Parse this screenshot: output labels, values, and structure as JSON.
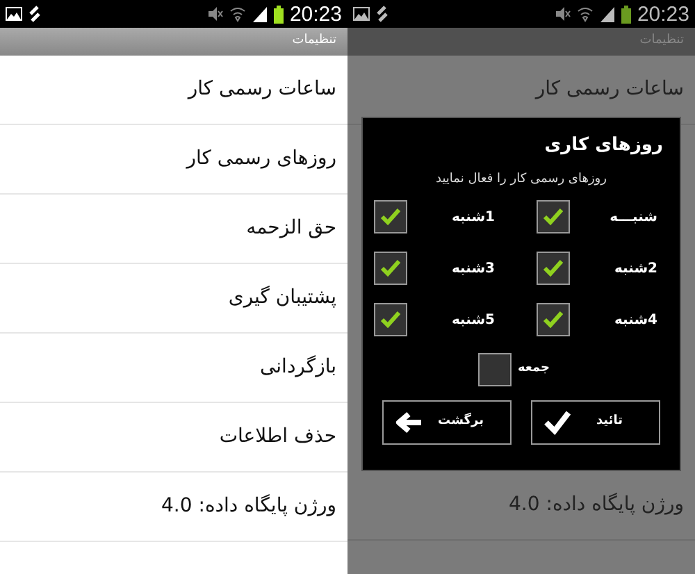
{
  "left_screen": {
    "status_bar": {
      "time": "20:23"
    },
    "title": "تنظیمات",
    "items": [
      {
        "label": "ساعات رسمی کار"
      },
      {
        "label": "روزهای رسمی کار"
      },
      {
        "label": "حق الزحمه"
      },
      {
        "label": "پشتیبان گیری"
      },
      {
        "label": "بازگردانی"
      },
      {
        "label": "حذف اطلاعات"
      },
      {
        "label": "ورژن پایگاه داده: 4.0"
      }
    ]
  },
  "right_screen": {
    "status_bar": {
      "time": "20:23"
    },
    "title": "تنظیمات",
    "items_above": [
      {
        "label": "ساعات رسمی کار"
      }
    ],
    "items_below": [
      {
        "label": "ورژن پایگاه داده: 4.0"
      }
    ],
    "dialog": {
      "title": "روزهای کاری",
      "subtitle": "روزهای رسمی کار را فعال نمایید",
      "days": [
        {
          "label": "1شنبه",
          "checked": true
        },
        {
          "label": "شنبـــه",
          "checked": true
        },
        {
          "label": "3شنبه",
          "checked": true
        },
        {
          "label": "2شنبه",
          "checked": true
        },
        {
          "label": "5شنبه",
          "checked": true
        },
        {
          "label": "4شنبه",
          "checked": true
        },
        {
          "label": "جمعه",
          "checked": false
        }
      ],
      "buttons": [
        {
          "label": "تائید",
          "kind": "confirm"
        },
        {
          "label": "برگشت",
          "kind": "back"
        }
      ]
    }
  }
}
